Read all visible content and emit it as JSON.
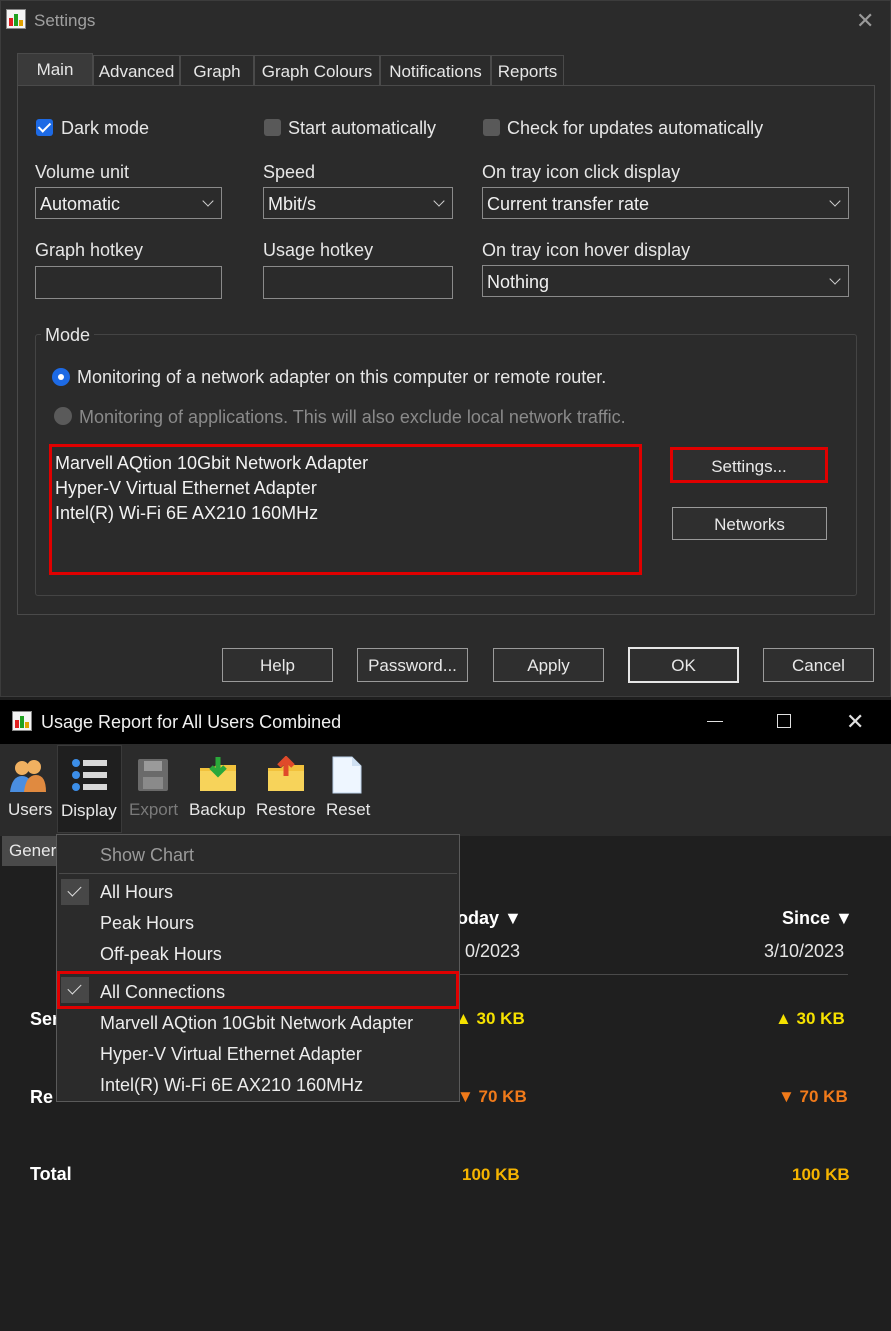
{
  "settings": {
    "title": "Settings",
    "close_icon": "close-icon",
    "tabs": [
      "Main",
      "Advanced",
      "Graph",
      "Graph Colours",
      "Notifications",
      "Reports"
    ],
    "active_tab": "Main",
    "dark_mode": {
      "label": "Dark mode",
      "checked": true
    },
    "start_automatically": {
      "label": "Start automatically",
      "checked": false
    },
    "check_updates": {
      "label": "Check for updates automatically",
      "checked": false
    },
    "volume_unit": {
      "label": "Volume unit",
      "value": "Automatic"
    },
    "speed": {
      "label": "Speed",
      "value": "Mbit/s"
    },
    "tray_click": {
      "label": "On tray icon click display",
      "value": "Current transfer rate"
    },
    "graph_hotkey": {
      "label": "Graph hotkey",
      "value": ""
    },
    "usage_hotkey": {
      "label": "Usage hotkey",
      "value": ""
    },
    "tray_hover": {
      "label": "On tray icon hover display",
      "value": "Nothing"
    },
    "mode": {
      "label": "Mode",
      "option_adapter": "Monitoring of a network adapter on this computer or remote router.",
      "option_apps": "Monitoring of applications. This will also exclude local network traffic.",
      "adapters": [
        "Marvell AQtion 10Gbit Network Adapter",
        "Hyper-V Virtual Ethernet Adapter",
        "Intel(R) Wi-Fi 6E AX210 160MHz"
      ],
      "settings_button": "Settings...",
      "networks_button": "Networks"
    },
    "buttons": {
      "help": "Help",
      "password": "Password...",
      "apply": "Apply",
      "ok": "OK",
      "cancel": "Cancel"
    },
    "highlight_color": "#e00000",
    "accent_color": "#1d6ae5"
  },
  "report": {
    "title": "Usage Report for All Users Combined",
    "window_controls": [
      "minimize-icon",
      "maximize-icon",
      "close-icon"
    ],
    "toolbar": [
      {
        "label": "Users",
        "icon": "users-icon",
        "enabled": true
      },
      {
        "label": "Display",
        "icon": "display-list-icon",
        "enabled": true
      },
      {
        "label": "Export",
        "icon": "floppy-disk-icon",
        "enabled": false
      },
      {
        "label": "Backup",
        "icon": "backup-folder-icon",
        "enabled": true
      },
      {
        "label": "Restore",
        "icon": "restore-folder-icon",
        "enabled": true
      },
      {
        "label": "Reset",
        "icon": "document-icon",
        "enabled": true
      }
    ],
    "tab_partial": "Gener",
    "columns": [
      {
        "head": "oday ▼",
        "date": "0/2023"
      },
      {
        "head": "Since ▼",
        "date": "3/10/2023"
      }
    ],
    "rows": {
      "sent": {
        "label_partial": "Ser",
        "today": "▲ 30 KB",
        "since": "▲ 30 KB"
      },
      "received": {
        "label_partial": "Re",
        "today": "▼ 70 KB",
        "since": "▼ 70 KB"
      },
      "total": {
        "label": "Total",
        "today": "100 KB",
        "since": "100 KB"
      }
    },
    "menu": {
      "show_chart": "Show Chart",
      "hours": [
        {
          "label": "All Hours",
          "checked": true
        },
        {
          "label": "Peak Hours",
          "checked": false
        },
        {
          "label": "Off-peak Hours",
          "checked": false
        }
      ],
      "connections": [
        {
          "label": "All Connections",
          "checked": true
        },
        {
          "label": "Marvell AQtion 10Gbit Network Adapter",
          "checked": false
        },
        {
          "label": "Hyper-V Virtual Ethernet Adapter",
          "checked": false
        },
        {
          "label": "Intel(R) Wi-Fi 6E AX210 160MHz",
          "checked": false
        }
      ]
    },
    "colors": {
      "sent": "#f5e100",
      "received": "#f07a1a",
      "total": "#f5b400"
    }
  }
}
